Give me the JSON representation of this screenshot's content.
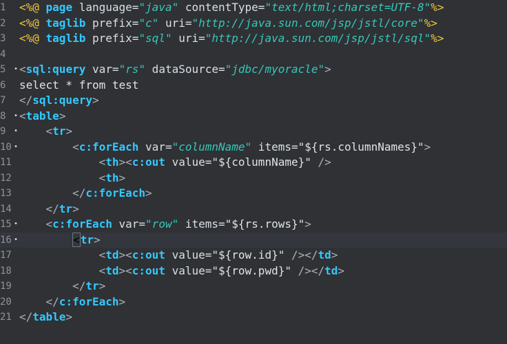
{
  "editor": {
    "lines": [
      {
        "n": "1",
        "marker": "",
        "tokens": [
          [
            "<%@",
            "t-dir"
          ],
          [
            " page ",
            "t-kw"
          ],
          [
            "language=",
            "t-attr"
          ],
          [
            "\"java\"",
            "t-str"
          ],
          [
            " contentType=",
            "t-attr"
          ],
          [
            "\"text/html;charset=UTF-8\"",
            "t-str"
          ],
          [
            "%>",
            "t-dir"
          ]
        ]
      },
      {
        "n": "2",
        "marker": "",
        "tokens": [
          [
            "<%@",
            "t-dir"
          ],
          [
            " taglib ",
            "t-kw"
          ],
          [
            "prefix=",
            "t-attr"
          ],
          [
            "\"c\"",
            "t-str"
          ],
          [
            " uri=",
            "t-attr"
          ],
          [
            "\"http://java.sun.com/jsp/jstl/core\"",
            "t-str"
          ],
          [
            "%>",
            "t-dir"
          ]
        ]
      },
      {
        "n": "3",
        "marker": "",
        "tokens": [
          [
            "<%@",
            "t-dir"
          ],
          [
            " taglib ",
            "t-kw"
          ],
          [
            "prefix=",
            "t-attr"
          ],
          [
            "\"sql\"",
            "t-str"
          ],
          [
            " uri=",
            "t-attr"
          ],
          [
            "\"http://java.sun.com/jsp/jstl/sql\"",
            "t-str"
          ],
          [
            "%>",
            "t-dir"
          ]
        ]
      },
      {
        "n": "4",
        "marker": "",
        "tokens": []
      },
      {
        "n": "5",
        "marker": "•",
        "tokens": [
          [
            "<",
            "t-bracket"
          ],
          [
            "sql:query",
            "t-kw"
          ],
          [
            " var=",
            "t-attr"
          ],
          [
            "\"rs\"",
            "t-str"
          ],
          [
            " dataSource=",
            "t-attr"
          ],
          [
            "\"jdbc/myoracle\"",
            "t-str"
          ],
          [
            ">",
            "t-bracket"
          ]
        ]
      },
      {
        "n": "6",
        "marker": "",
        "tokens": [
          [
            "select * from test",
            "t-white"
          ]
        ]
      },
      {
        "n": "7",
        "marker": "",
        "tokens": [
          [
            "</",
            "t-bracket"
          ],
          [
            "sql:query",
            "t-kw"
          ],
          [
            ">",
            "t-bracket"
          ]
        ]
      },
      {
        "n": "8",
        "marker": "•",
        "tokens": [
          [
            "<",
            "t-bracket"
          ],
          [
            "table",
            "t-kw"
          ],
          [
            ">",
            "t-bracket"
          ]
        ]
      },
      {
        "n": "9",
        "marker": "•",
        "tokens": [
          [
            "    <",
            "t-bracket"
          ],
          [
            "tr",
            "t-kw"
          ],
          [
            ">",
            "t-bracket"
          ]
        ]
      },
      {
        "n": "10",
        "marker": "•",
        "tokens": [
          [
            "        <",
            "t-bracket"
          ],
          [
            "c:forEach",
            "t-kw"
          ],
          [
            " var=",
            "t-attr"
          ],
          [
            "\"columnName\"",
            "t-str"
          ],
          [
            " items=",
            "t-attr"
          ],
          [
            "\"${rs.columnNames}\"",
            "t-str2"
          ],
          [
            ">",
            "t-bracket"
          ]
        ]
      },
      {
        "n": "11",
        "marker": "",
        "tokens": [
          [
            "            <",
            "t-bracket"
          ],
          [
            "th",
            "t-kw"
          ],
          [
            "><",
            "t-bracket"
          ],
          [
            "c:out",
            "t-kw"
          ],
          [
            " value=",
            "t-attr"
          ],
          [
            "\"${columnName}\"",
            "t-str2"
          ],
          [
            " />",
            "t-bracket"
          ]
        ]
      },
      {
        "n": "12",
        "marker": "",
        "tokens": [
          [
            "            <",
            "t-bracket"
          ],
          [
            "th",
            "t-kw"
          ],
          [
            ">",
            "t-bracket"
          ]
        ]
      },
      {
        "n": "13",
        "marker": "",
        "tokens": [
          [
            "        </",
            "t-bracket"
          ],
          [
            "c:forEach",
            "t-kw"
          ],
          [
            ">",
            "t-bracket"
          ]
        ]
      },
      {
        "n": "14",
        "marker": "",
        "tokens": [
          [
            "    </",
            "t-bracket"
          ],
          [
            "tr",
            "t-kw"
          ],
          [
            ">",
            "t-bracket"
          ]
        ]
      },
      {
        "n": "15",
        "marker": "•",
        "tokens": [
          [
            "    <",
            "t-bracket"
          ],
          [
            "c:forEach",
            "t-kw"
          ],
          [
            " var=",
            "t-attr"
          ],
          [
            "\"row\"",
            "t-str"
          ],
          [
            " items=",
            "t-attr"
          ],
          [
            "\"${rs.rows}\"",
            "t-str2"
          ],
          [
            ">",
            "t-bracket"
          ]
        ]
      },
      {
        "n": "16",
        "marker": "•",
        "current": true,
        "tokens": [
          [
            "        ",
            "t-white"
          ],
          [
            "<",
            "t-cur"
          ],
          [
            "tr",
            "t-kw"
          ],
          [
            ">",
            "t-bracket"
          ]
        ]
      },
      {
        "n": "17",
        "marker": "",
        "tokens": [
          [
            "            <",
            "t-bracket"
          ],
          [
            "td",
            "t-kw"
          ],
          [
            "><",
            "t-bracket"
          ],
          [
            "c:out",
            "t-kw"
          ],
          [
            " value=",
            "t-attr"
          ],
          [
            "\"${row.id}\"",
            "t-str2"
          ],
          [
            " /></",
            "t-bracket"
          ],
          [
            "td",
            "t-kw"
          ],
          [
            ">",
            "t-bracket"
          ]
        ]
      },
      {
        "n": "18",
        "marker": "",
        "tokens": [
          [
            "            <",
            "t-bracket"
          ],
          [
            "td",
            "t-kw"
          ],
          [
            "><",
            "t-bracket"
          ],
          [
            "c:out",
            "t-kw"
          ],
          [
            " value=",
            "t-attr"
          ],
          [
            "\"${row.pwd}\"",
            "t-str2"
          ],
          [
            " /></",
            "t-bracket"
          ],
          [
            "td",
            "t-kw"
          ],
          [
            ">",
            "t-bracket"
          ]
        ]
      },
      {
        "n": "19",
        "marker": "",
        "tokens": [
          [
            "        </",
            "t-bracket"
          ],
          [
            "tr",
            "t-kw"
          ],
          [
            ">",
            "t-bracket"
          ]
        ]
      },
      {
        "n": "20",
        "marker": "",
        "tokens": [
          [
            "    </",
            "t-bracket"
          ],
          [
            "c:forEach",
            "t-kw"
          ],
          [
            ">",
            "t-bracket"
          ]
        ]
      },
      {
        "n": "21",
        "marker": "",
        "tokens": [
          [
            "</",
            "t-bracket"
          ],
          [
            "table",
            "t-kw"
          ],
          [
            ">",
            "t-bracket"
          ]
        ]
      }
    ]
  }
}
